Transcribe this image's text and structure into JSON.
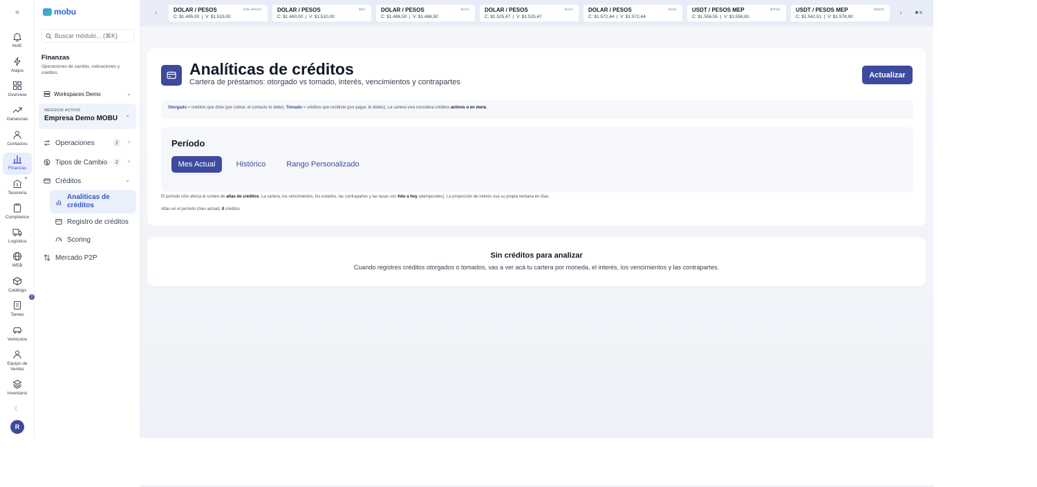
{
  "rail": {
    "items": [
      {
        "label": "Notif.",
        "icon": "bell-icon"
      },
      {
        "label": "Atajos",
        "icon": "lightning-icon"
      },
      {
        "label": "Overview",
        "icon": "grid-icon"
      },
      {
        "label": "Ganancias",
        "icon": "trend-up-icon"
      },
      {
        "label": "Contactos",
        "icon": "users-icon"
      },
      {
        "label": "Finanzas",
        "icon": "bar-chart-icon"
      },
      {
        "label": "Tesorería",
        "icon": "bank-icon"
      },
      {
        "label": "Compliance",
        "icon": "clipboard-icon"
      },
      {
        "label": "Logística",
        "icon": "truck-icon"
      },
      {
        "label": "WEB",
        "icon": "globe-icon"
      },
      {
        "label": "Catálogo",
        "icon": "box-icon"
      },
      {
        "label": "Tareas",
        "icon": "tasks-icon"
      },
      {
        "label": "Vehículos",
        "icon": "car-icon"
      },
      {
        "label": "Equipo de Ventas",
        "icon": "team-icon"
      },
      {
        "label": "Inventario",
        "icon": "stack-icon"
      }
    ],
    "active_index": 5,
    "tasks_badge": "2",
    "avatar_initial": "R"
  },
  "sidebar": {
    "logo": "mobu",
    "search_placeholder": "Buscar módulo... (⌘K)",
    "section_title": "Finanzas",
    "section_desc": "Operaciones de cambio, cotizaciones y créditos.",
    "workspace": "Workspaces Demo",
    "biz_label": "NEGOCIO ACTIVO",
    "biz_name": "Empresa Demo MOBU",
    "nav": [
      {
        "label": "Operaciones",
        "badge": "2"
      },
      {
        "label": "Tipos de Cambio",
        "badge": "2"
      },
      {
        "label": "Créditos"
      }
    ],
    "credit_sub": [
      {
        "label": "Analíticas de créditos"
      },
      {
        "label": "Registro de créditos"
      },
      {
        "label": "Scoring"
      }
    ],
    "p2p": "Mercado P2P"
  },
  "ticker": [
    {
      "title": "DOLAR / PESOS",
      "source": "DOLARHOY",
      "c": "C: $1.495,00",
      "v": "V: $1.515,00"
    },
    {
      "title": "DOLAR / PESOS",
      "source": "BNA",
      "c": "C: $1.460,00",
      "v": "V: $1.510,00"
    },
    {
      "title": "DOLAR / PESOS",
      "source": "RAVA",
      "c": "C: $1.486,50",
      "v": "V: $1.486,50"
    },
    {
      "title": "DOLAR / PESOS",
      "source": "RAVA",
      "c": "C: $1.525,47",
      "v": "V: $1.525,47"
    },
    {
      "title": "DOLAR / PESOS",
      "source": "RAVA",
      "c": "C: $1.572,44",
      "v": "V: $1.572,44"
    },
    {
      "title": "USDT / PESOS MEP",
      "source": "BITSO",
      "c": "C: $1.556,55",
      "v": "V: $1.556,81"
    },
    {
      "title": "USDT / PESOS MEP",
      "source": "BINCE",
      "c": "C: $1.542,51",
      "v": "V: $1.578,90"
    }
  ],
  "header": {
    "title": "Analíticas de créditos",
    "subtitle": "Cartera de préstamos: otorgado vs tomado, interés, vencimientos y contrapartes",
    "refresh_label": "Actualizar"
  },
  "legend": {
    "otorgado": "Otorgado",
    "otorgado_text": " = créditos que diste (por cobrar, el contacto te debe). ",
    "tomado": "Tomado",
    "tomado_text": " = créditos que recibiste (por pagar, le debés). La cartera viva considera créditos ",
    "bold_text": "activos o en mora",
    "end": "."
  },
  "period": {
    "title": "Período",
    "tabs": [
      "Mes Actual",
      "Histórico",
      "Rango Personalizado"
    ],
    "active_tab": 0
  },
  "notes": {
    "n1_a": "El período sólo afecta el conteo de ",
    "n1_b": "altas de créditos",
    "n1_c": ". La cartera, los vencimientos, los estados, las contrapartes y las tasas son ",
    "n1_d": "foto a hoy",
    "n1_e": " (atemporales). La proyección de interés usa su propia ventana en días.",
    "n2_a": "Altas en el período (mes actual): ",
    "n2_b": "0",
    "n2_c": " créditos"
  },
  "empty": {
    "title": "Sin créditos para analizar",
    "subtitle": "Cuando registres créditos otorgados o tomados, vas a ver acá tu cartera por moneda, el interés, los vencimientos y las contrapartes."
  },
  "colors": {
    "accent": "#3e4a9e",
    "ticker_bg": "#e8ecf6",
    "active_bg": "#e8edfd"
  }
}
